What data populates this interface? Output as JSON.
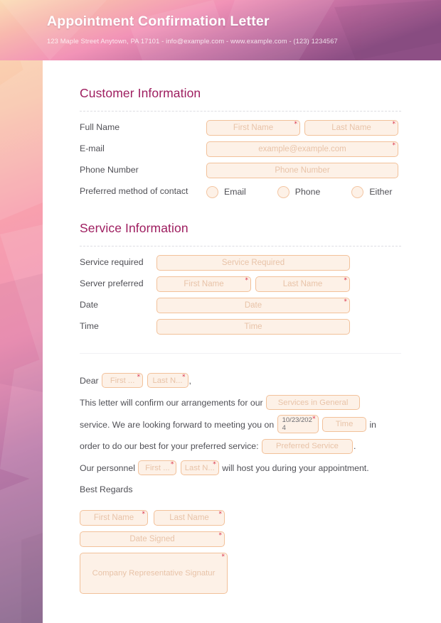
{
  "header": {
    "title": "Appointment Confirmation Letter",
    "contact": "123 Maple Street Anytown, PA 17101 - info@example.com - www.example.com - (123) 1234567"
  },
  "customer_section": {
    "heading": "Customer Information",
    "rows": [
      {
        "label": "Full Name"
      },
      {
        "label": "E-mail"
      },
      {
        "label": "Phone Number"
      },
      {
        "label": "Preferred method of contact"
      }
    ],
    "fields": {
      "first_name": "First Name",
      "last_name": "Last Name",
      "email": "example@example.com",
      "phone": "Phone Number"
    },
    "contact_options": [
      "Email",
      "Phone",
      "Either"
    ]
  },
  "service_section": {
    "heading": "Service Information",
    "rows": [
      {
        "label": "Service required"
      },
      {
        "label": "Server preferred"
      },
      {
        "label": "Date"
      },
      {
        "label": "Time"
      }
    ],
    "fields": {
      "service_required": "Service Required",
      "server_first_name": "First Name",
      "server_last_name": "Last Name",
      "date": "Date",
      "time": "Time"
    }
  },
  "letter": {
    "salutation": "Dear",
    "salutation_first": "First ...",
    "salutation_last": "Last N...",
    "comma": ",",
    "line1_a": "This letter will confirm our arrangements for our",
    "services_in_general": "Services in General",
    "line2_a": "service. We are looking forward to meeting you on",
    "date_value": "10/23/2024",
    "time_placeholder": "Time",
    "line2_b": "in",
    "line3_a": "order to do our best for your preferred service:",
    "preferred_service": "Preferred Service",
    "period": ".",
    "line4_a": "Our personnel",
    "personnel_first": "First ...",
    "personnel_last": "Last N...",
    "line4_b": "will host you during your appointment.",
    "closing": "Best Regards"
  },
  "signature": {
    "first_name": "First Name",
    "last_name": "Last Name",
    "date_signed": "Date Signed",
    "rep_signature": "Company Representative Signatur"
  },
  "symbols": {
    "required": "*"
  },
  "colors": {
    "heading": "#9e1d5f",
    "field_border": "#f2c19a",
    "field_fill": "#fdf1e7",
    "placeholder": "#e8c3a8",
    "required_star": "#d8304a",
    "body_text": "#4f4f55"
  }
}
